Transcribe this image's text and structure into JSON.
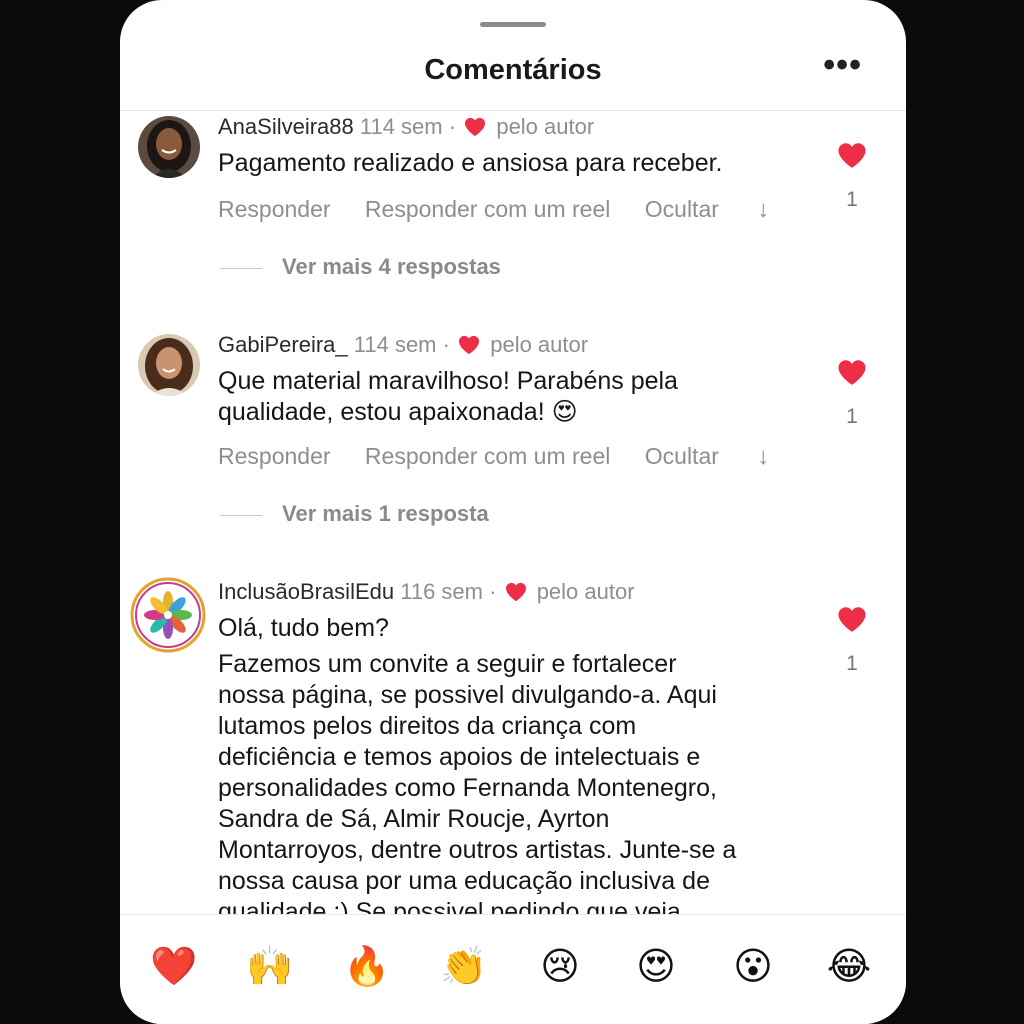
{
  "header": {
    "title": "Comentários",
    "more": "•••"
  },
  "comments": [
    {
      "user": "AnaSilveira88",
      "time": "114 sem",
      "sep": "·",
      "author_like": "pelo autor",
      "text": "Pagamento realizado e ansiosa para receber.",
      "likes": "1",
      "actions": {
        "reply": "Responder",
        "reel": "Responder com um reel",
        "hide": "Ocultar",
        "arrow": "↓"
      },
      "more_replies": "Ver mais 4 respostas"
    },
    {
      "user": "GabiPereira_",
      "time": "114 sem",
      "sep": "·",
      "author_like": "pelo autor",
      "text_line1": "Que material maravilhoso! Parabéns pela",
      "text_line2": "qualidade, estou apaixonada! 😍",
      "likes": "1",
      "actions": {
        "reply": "Responder",
        "reel": "Responder com um reel",
        "hide": "Ocultar",
        "arrow": "↓"
      },
      "more_replies": "Ver mais 1 resposta"
    },
    {
      "user": "InclusãoBrasilEdu",
      "time": "116 sem",
      "sep": "·",
      "author_like": "pelo autor",
      "greeting": "Olá, tudo bem?",
      "lines": [
        "Fazemos um convite a seguir e fortalecer",
        "nossa página, se possivel divulgando-a. Aqui",
        "lutamos pelos direitos da criança com",
        "deficiência e temos apoios de intelectuais e",
        "personalidades como Fernanda Montenegro,",
        "Sandra de Sá, Almir Roucje, Ayrton",
        "Montarroyos, dentre outros artistas. Junte-se a",
        "nossa causa por uma educação inclusiva de",
        "qualidade :) Se possivel pedindo que veja"
      ],
      "likes": "1"
    }
  ],
  "reactions": [
    "❤️",
    "🙌",
    "🔥",
    "👏",
    "😢",
    "😍",
    "😮",
    "😂"
  ],
  "colors": {
    "heart": "#ed2e47",
    "muted": "#8e8e8e"
  }
}
